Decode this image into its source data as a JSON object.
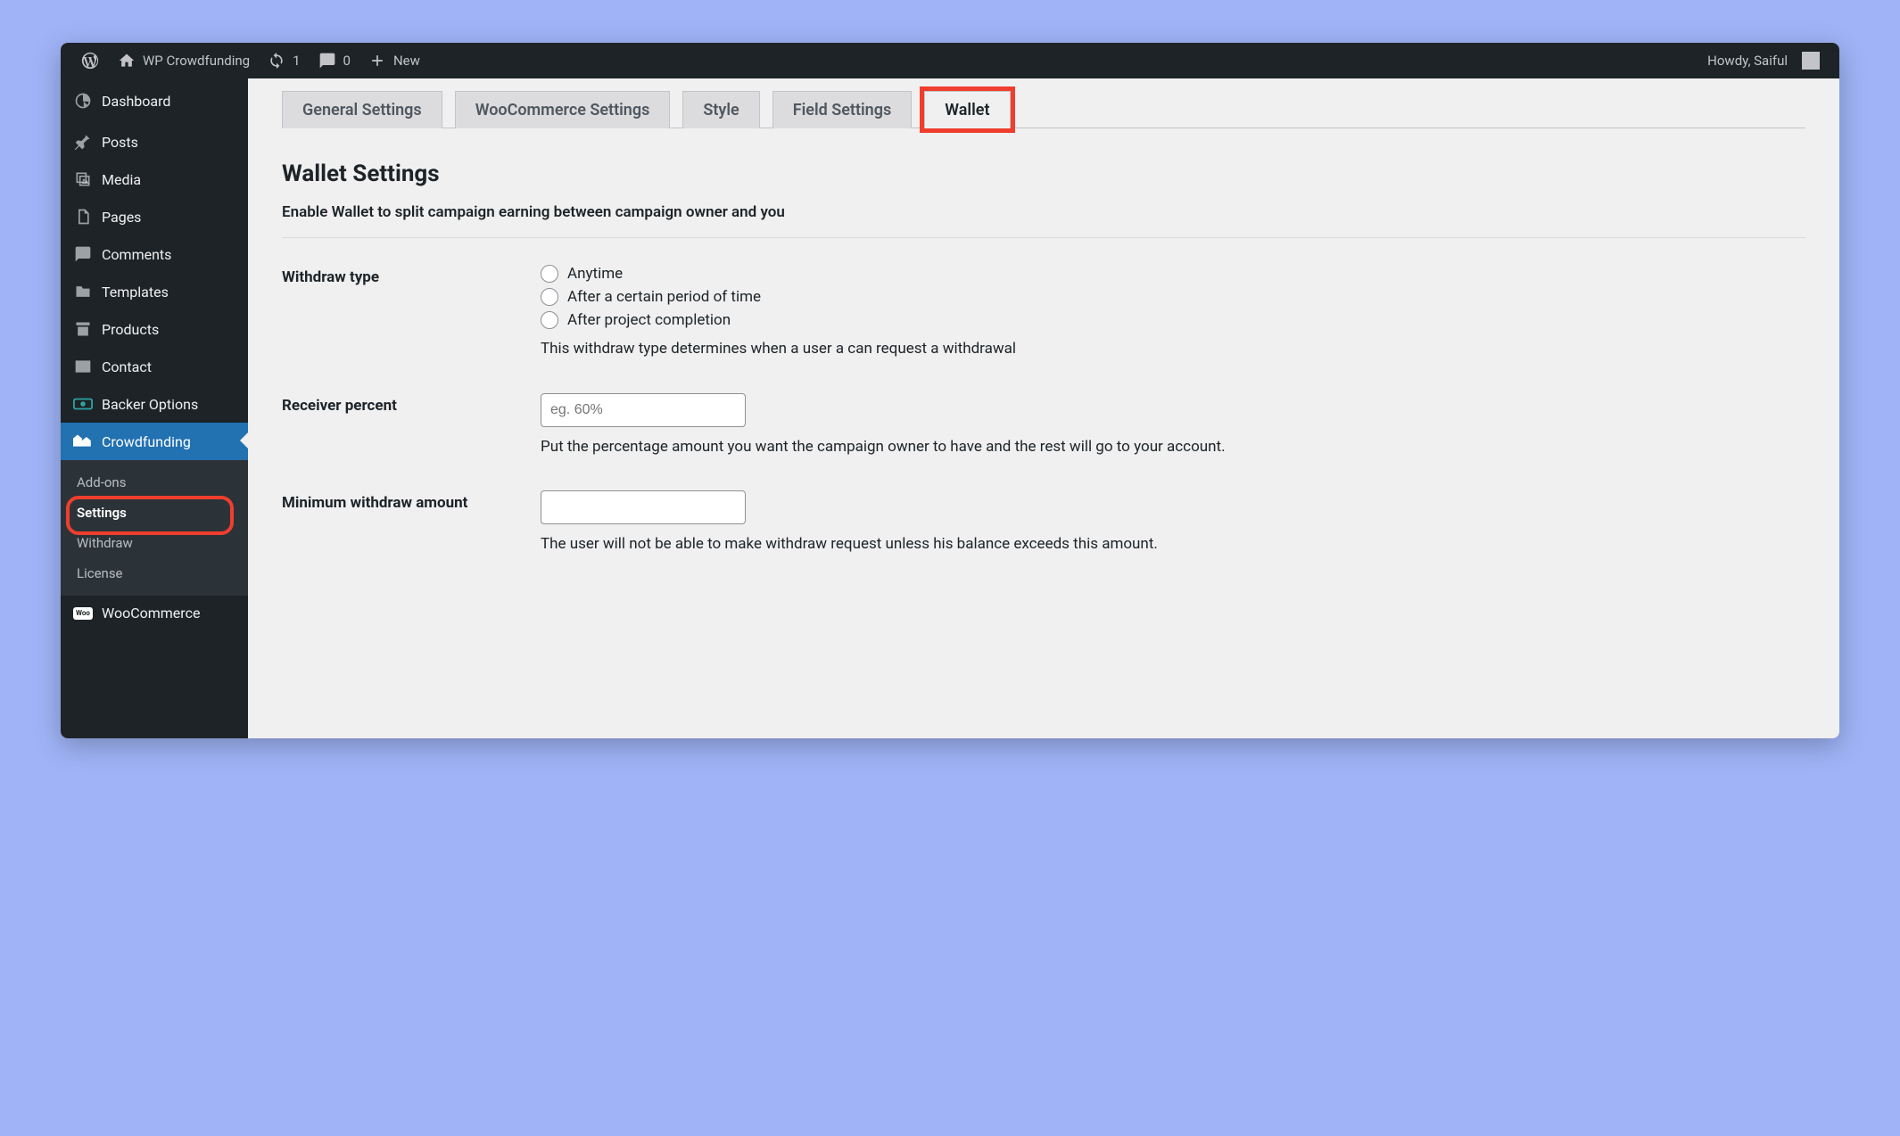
{
  "adminbar": {
    "site_title": "WP Crowdfunding",
    "updates": "1",
    "comments": "0",
    "new": "New",
    "howdy": "Howdy, Saiful"
  },
  "sidebar": {
    "items": [
      {
        "label": "Dashboard",
        "icon": "dashboard"
      },
      {
        "label": "Posts",
        "icon": "pin"
      },
      {
        "label": "Media",
        "icon": "media"
      },
      {
        "label": "Pages",
        "icon": "pages"
      },
      {
        "label": "Comments",
        "icon": "comment"
      },
      {
        "label": "Templates",
        "icon": "templates"
      },
      {
        "label": "Products",
        "icon": "archive"
      },
      {
        "label": "Contact",
        "icon": "mail"
      },
      {
        "label": "Backer Options",
        "icon": "money"
      },
      {
        "label": "Crowdfunding",
        "icon": "houses"
      },
      {
        "label": "WooCommerce",
        "icon": "woo"
      }
    ],
    "submenu": [
      {
        "label": "Add-ons"
      },
      {
        "label": "Settings"
      },
      {
        "label": "Withdraw"
      },
      {
        "label": "License"
      }
    ]
  },
  "tabs": [
    {
      "label": "General Settings"
    },
    {
      "label": "WooCommerce Settings"
    },
    {
      "label": "Style"
    },
    {
      "label": "Field Settings"
    },
    {
      "label": "Wallet"
    }
  ],
  "page": {
    "title": "Wallet Settings",
    "desc": "Enable Wallet to split campaign earning between campaign owner and you",
    "withdraw_type": {
      "label": "Withdraw type",
      "options": [
        "Anytime",
        "After a certain period of time",
        "After project completion"
      ],
      "help": "This withdraw type determines when a user a can request a withdrawal"
    },
    "receiver_percent": {
      "label": "Receiver percent",
      "placeholder": "eg. 60%",
      "value": "",
      "help": "Put the percentage amount you want the campaign owner to have and the rest will go to your account."
    },
    "min_withdraw": {
      "label": "Minimum withdraw amount",
      "value": "",
      "help": "The user will not be able to make withdraw request unless his balance exceeds this amount."
    }
  },
  "highlight": {
    "tab_index": 4,
    "submenu_index": 1
  }
}
